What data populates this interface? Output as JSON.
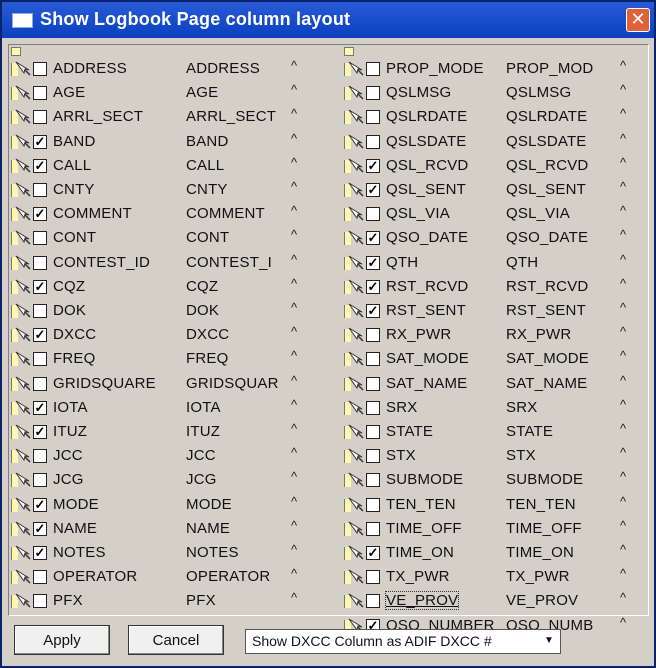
{
  "window": {
    "title": "Show Logbook Page column layout",
    "close_glyph": "✕"
  },
  "left_column": [
    {
      "name": "ADDRESS",
      "label": "ADDRESS",
      "checked": false
    },
    {
      "name": "AGE",
      "label": "AGE",
      "checked": false
    },
    {
      "name": "ARRL_SECT",
      "label": "ARRL_SECT",
      "checked": false
    },
    {
      "name": "BAND",
      "label": "BAND",
      "checked": true
    },
    {
      "name": "CALL",
      "label": "CALL",
      "checked": true
    },
    {
      "name": "CNTY",
      "label": "CNTY",
      "checked": false
    },
    {
      "name": "COMMENT",
      "label": "COMMENT",
      "checked": true
    },
    {
      "name": "CONT",
      "label": "CONT",
      "checked": false
    },
    {
      "name": "CONTEST_ID",
      "label": "CONTEST_I",
      "checked": false
    },
    {
      "name": "CQZ",
      "label": "CQZ",
      "checked": true
    },
    {
      "name": "DOK",
      "label": "DOK",
      "checked": false
    },
    {
      "name": "DXCC",
      "label": "DXCC",
      "checked": true
    },
    {
      "name": "FREQ",
      "label": "FREQ",
      "checked": false
    },
    {
      "name": "GRIDSQUARE",
      "label": "GRIDSQUAR",
      "checked": false
    },
    {
      "name": "IOTA",
      "label": "IOTA",
      "checked": true
    },
    {
      "name": "ITUZ",
      "label": "ITUZ",
      "checked": true
    },
    {
      "name": "JCC",
      "label": "JCC",
      "checked": false
    },
    {
      "name": "JCG",
      "label": "JCG",
      "checked": false
    },
    {
      "name": "MODE",
      "label": "MODE",
      "checked": true
    },
    {
      "name": "NAME",
      "label": "NAME",
      "checked": true
    },
    {
      "name": "NOTES",
      "label": "NOTES",
      "checked": true
    },
    {
      "name": "OPERATOR",
      "label": "OPERATOR",
      "checked": false
    },
    {
      "name": "PFX",
      "label": "PFX",
      "checked": false
    }
  ],
  "right_column": [
    {
      "name": "PROP_MODE",
      "label": "PROP_MOD",
      "checked": false
    },
    {
      "name": "QSLMSG",
      "label": "QSLMSG",
      "checked": false
    },
    {
      "name": "QSLRDATE",
      "label": "QSLRDATE",
      "checked": false
    },
    {
      "name": "QSLSDATE",
      "label": "QSLSDATE",
      "checked": false
    },
    {
      "name": "QSL_RCVD",
      "label": "QSL_RCVD",
      "checked": true
    },
    {
      "name": "QSL_SENT",
      "label": "QSL_SENT",
      "checked": true
    },
    {
      "name": "QSL_VIA",
      "label": "QSL_VIA",
      "checked": false
    },
    {
      "name": "QSO_DATE",
      "label": "QSO_DATE",
      "checked": true
    },
    {
      "name": "QTH",
      "label": "QTH",
      "checked": true
    },
    {
      "name": "RST_RCVD",
      "label": "RST_RCVD",
      "checked": true
    },
    {
      "name": "RST_SENT",
      "label": "RST_SENT",
      "checked": true
    },
    {
      "name": "RX_PWR",
      "label": "RX_PWR",
      "checked": false
    },
    {
      "name": "SAT_MODE",
      "label": "SAT_MODE",
      "checked": false
    },
    {
      "name": "SAT_NAME",
      "label": "SAT_NAME",
      "checked": false
    },
    {
      "name": "SRX",
      "label": "SRX",
      "checked": false
    },
    {
      "name": "STATE",
      "label": "STATE",
      "checked": false
    },
    {
      "name": "STX",
      "label": "STX",
      "checked": false
    },
    {
      "name": "SUBMODE",
      "label": "SUBMODE",
      "checked": false
    },
    {
      "name": "TEN_TEN",
      "label": "TEN_TEN",
      "checked": false
    },
    {
      "name": "TIME_OFF",
      "label": "TIME_OFF",
      "checked": false
    },
    {
      "name": "TIME_ON",
      "label": "TIME_ON",
      "checked": true
    },
    {
      "name": "TX_PWR",
      "label": "TX_PWR",
      "checked": false
    },
    {
      "name": "VE_PROV",
      "label": "VE_PROV",
      "checked": false,
      "focused": true
    },
    {
      "name": "QSO_NUMBER",
      "label": "QSO_NUMB",
      "checked": true
    }
  ],
  "caret_glyph": "^",
  "check_glyph": "✓",
  "footer": {
    "apply_label": "Apply",
    "cancel_label": "Cancel",
    "dxcc_select_value": "Show DXCC Column as ADIF DXCC #",
    "dropdown_arrow": "▼"
  },
  "colors": {
    "title_bar": "#0a3fbf",
    "dialog_bg": "#d4d0c8",
    "close_button": "#e0623a"
  }
}
